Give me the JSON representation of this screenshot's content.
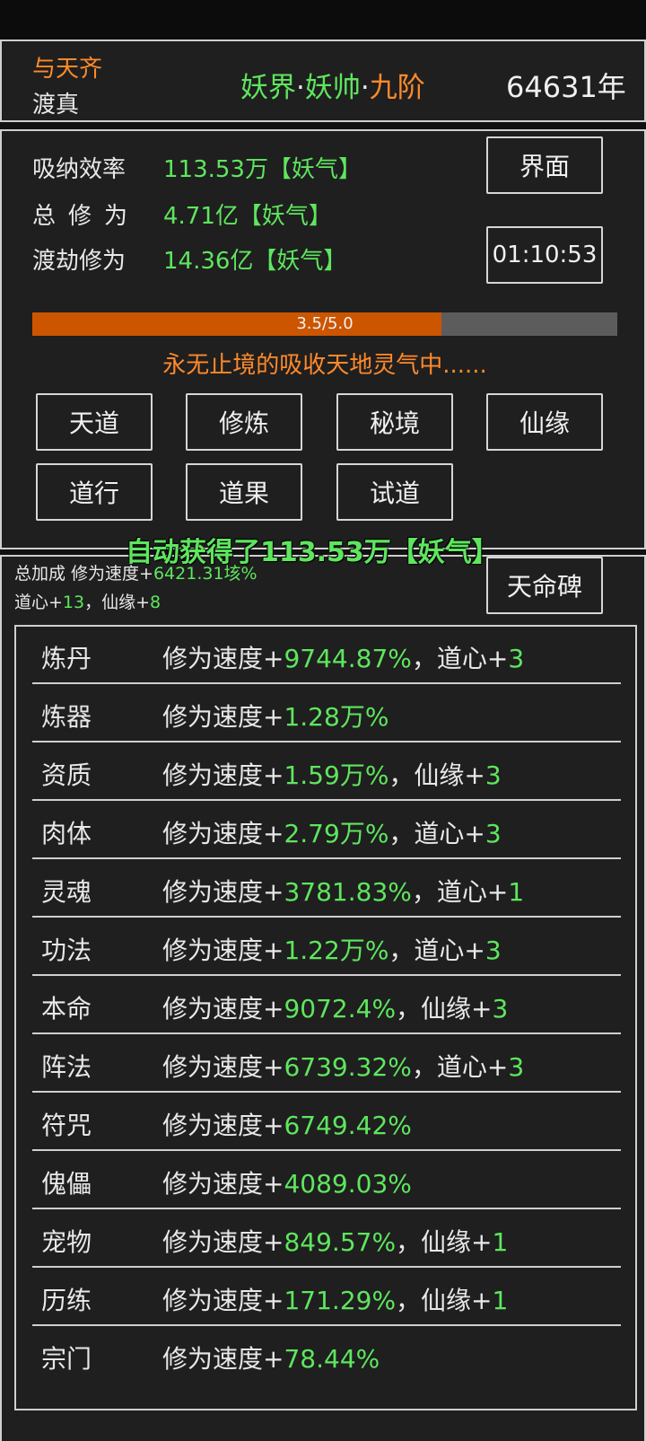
{
  "header": {
    "name": "与天齐",
    "sub": "渡真",
    "realm_world": "妖界",
    "dot1": "·",
    "realm_rank": "妖帅",
    "dot2": "·",
    "realm_level": "九阶",
    "year": "64631年"
  },
  "stats": {
    "absorb_label": "吸纳效率",
    "absorb_value": "113.53万【妖气】",
    "total_label": "总修为",
    "total_value": "4.71亿【妖气】",
    "tribulation_label": "渡劫修为",
    "tribulation_value": "14.36亿【妖气】"
  },
  "buttons": {
    "interface": "界面",
    "timer": "01:10:53"
  },
  "progress": {
    "text": "3.5/5.0",
    "value": 3.5,
    "max": 5.0
  },
  "status_text": "永无止境的吸收天地灵气中......",
  "menu": [
    "天道",
    "修炼",
    "秘境",
    "仙缘",
    "道行",
    "道果",
    "试道"
  ],
  "toast": "自动获得了113.53万【妖气】",
  "bonus": {
    "summary_prefix": "总加成 修为速度+",
    "summary_value": "6421.31垓%",
    "daoxin_label": "道心+",
    "daoxin_value": "13",
    "sep": "，",
    "xianyuan_label": "仙缘+",
    "xianyuan_value": "8",
    "stele_button": "天命碑"
  },
  "rows": [
    {
      "name": "炼丹",
      "prefix": "修为速度+",
      "pct": "9744.87%",
      "extra_label": "，道心+",
      "extra_value": "3"
    },
    {
      "name": "炼器",
      "prefix": "修为速度+",
      "pct": "1.28万%",
      "extra_label": "",
      "extra_value": ""
    },
    {
      "name": "资质",
      "prefix": "修为速度+",
      "pct": "1.59万%",
      "extra_label": "，仙缘+",
      "extra_value": "3"
    },
    {
      "name": "肉体",
      "prefix": "修为速度+",
      "pct": "2.79万%",
      "extra_label": "，道心+",
      "extra_value": "3"
    },
    {
      "name": "灵魂",
      "prefix": "修为速度+",
      "pct": "3781.83%",
      "extra_label": "，道心+",
      "extra_value": "1"
    },
    {
      "name": "功法",
      "prefix": "修为速度+",
      "pct": "1.22万%",
      "extra_label": "，道心+",
      "extra_value": "3"
    },
    {
      "name": "本命",
      "prefix": "修为速度+",
      "pct": "9072.4%",
      "extra_label": "，仙缘+",
      "extra_value": "3"
    },
    {
      "name": "阵法",
      "prefix": "修为速度+",
      "pct": "6739.32%",
      "extra_label": "，道心+",
      "extra_value": "3"
    },
    {
      "name": "符咒",
      "prefix": "修为速度+",
      "pct": "6749.42%",
      "extra_label": "",
      "extra_value": ""
    },
    {
      "name": "傀儡",
      "prefix": "修为速度+",
      "pct": "4089.03%",
      "extra_label": "",
      "extra_value": ""
    },
    {
      "name": "宠物",
      "prefix": "修为速度+",
      "pct": "849.57%",
      "extra_label": "，仙缘+",
      "extra_value": "1"
    },
    {
      "name": "历练",
      "prefix": "修为速度+",
      "pct": "171.29%",
      "extra_label": "，仙缘+",
      "extra_value": "1"
    },
    {
      "name": "宗门",
      "prefix": "修为速度+",
      "pct": "78.44%",
      "extra_label": "",
      "extra_value": ""
    }
  ],
  "colors": {
    "green": "#5ee65e",
    "orange": "#ff8a2a",
    "progress_fill": "#cc5500",
    "panel_bg": "#1f1f1f"
  }
}
